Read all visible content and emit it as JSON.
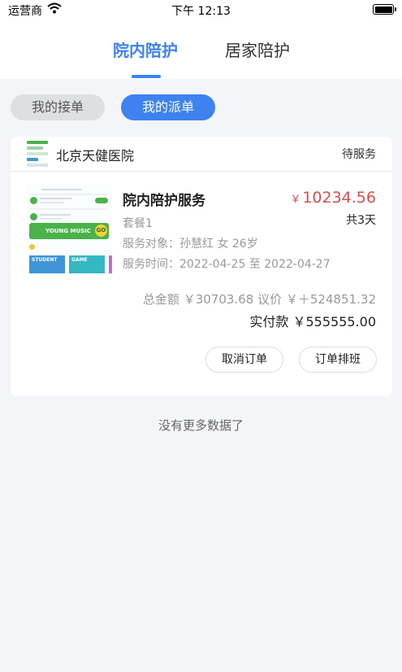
{
  "status_bar": {
    "carrier": "运营商",
    "time": "下午 12:13"
  },
  "top_tabs": [
    {
      "label": "院内陪护",
      "active": true
    },
    {
      "label": "居家陪护",
      "active": false
    }
  ],
  "sub_tabs": [
    {
      "label": "我的接单",
      "active": false
    },
    {
      "label": "我的派单",
      "active": true
    }
  ],
  "order": {
    "hospital_name": "北京天健医院",
    "status": "待服务",
    "service_title": "院内陪护服务",
    "price_currency": "￥",
    "price": "10234.56",
    "package": "套餐1",
    "days": "共3天",
    "target": "服务对象：孙慧红 女 26岁",
    "time": "服务时间：2022-04-25 至 2022-04-27",
    "total_label": "总金额",
    "total_value": "￥30703.68",
    "negotiated_label": "议价",
    "negotiated_value": "￥＋524851.32",
    "paid_label": "实付款",
    "paid_value": "￥555555.00",
    "buttons": {
      "cancel": "取消订单",
      "schedule": "订单排班"
    },
    "thumbnail": {
      "banner_text": "YOUNG MUSIC",
      "go_text": "GO",
      "tile_a": "STUDENT",
      "tile_b": "GAME"
    }
  },
  "footer_text": "没有更多数据了",
  "colors": {
    "accent": "#3d82f0",
    "price": "#e04a4a"
  }
}
